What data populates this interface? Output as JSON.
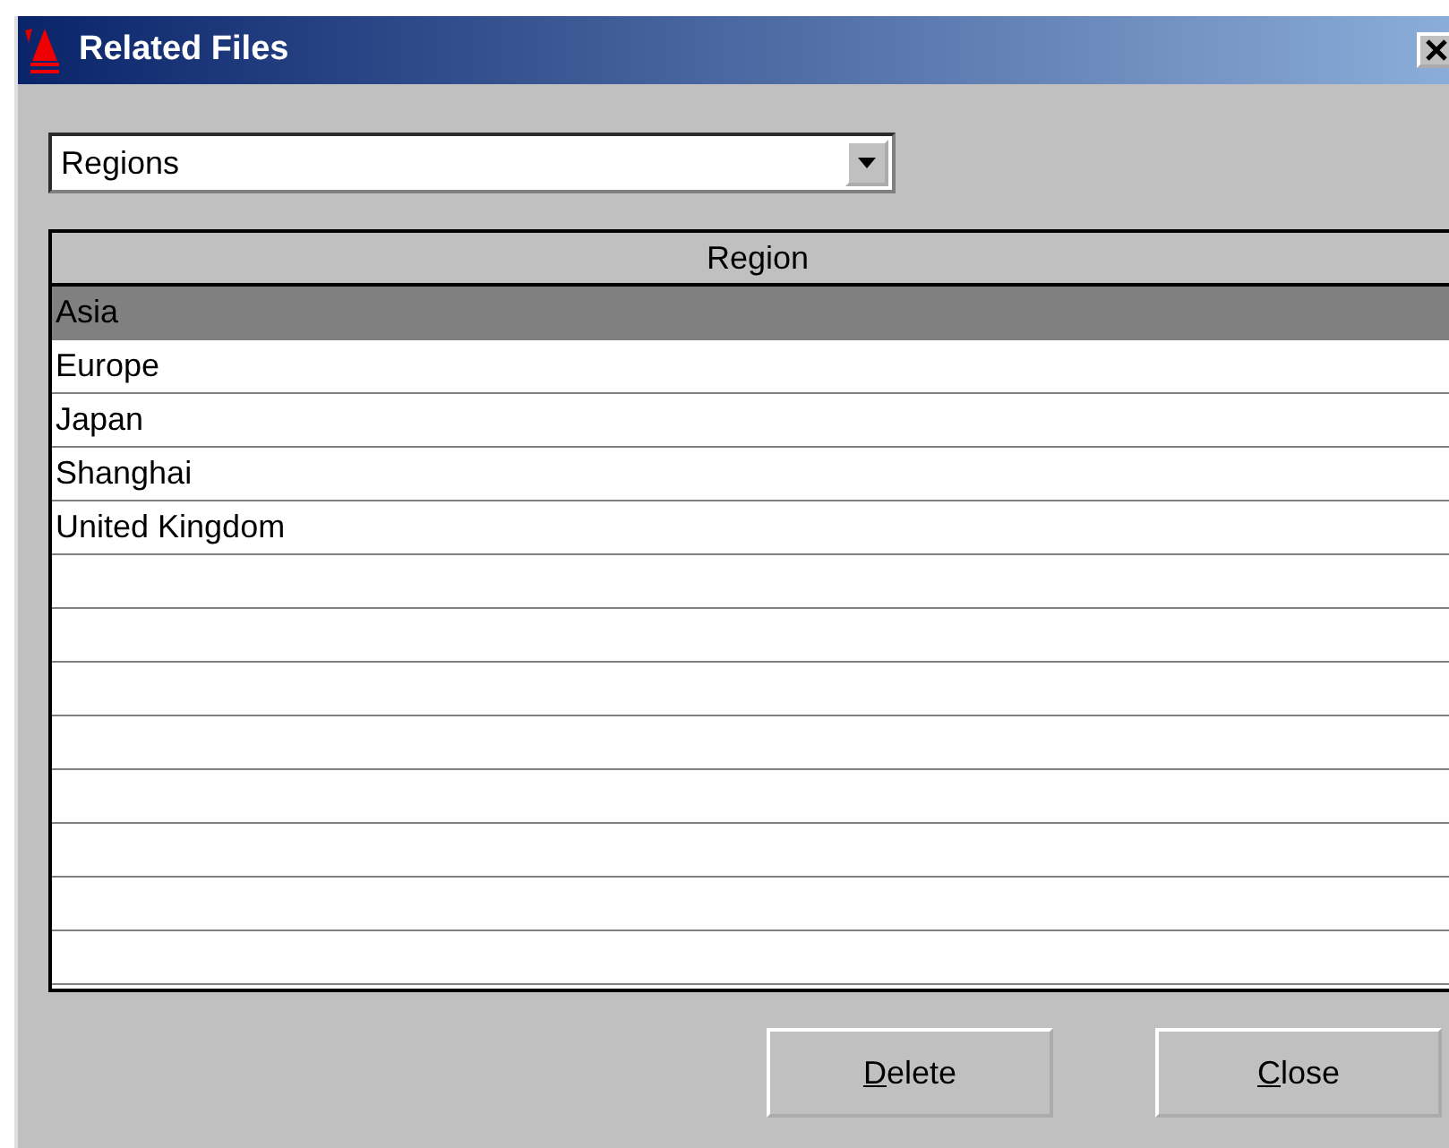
{
  "window": {
    "title": "Related Files"
  },
  "dropdown": {
    "value": "Regions"
  },
  "table": {
    "columns": [
      "Region"
    ],
    "rows": [
      {
        "cells": [
          "Asia"
        ],
        "selected": true
      },
      {
        "cells": [
          "Europe"
        ],
        "selected": false
      },
      {
        "cells": [
          "Japan"
        ],
        "selected": false
      },
      {
        "cells": [
          "Shanghai"
        ],
        "selected": false
      },
      {
        "cells": [
          "United Kingdom"
        ],
        "selected": false
      }
    ]
  },
  "buttons": [
    {
      "label": "Delete"
    },
    {
      "label": "Close"
    }
  ]
}
